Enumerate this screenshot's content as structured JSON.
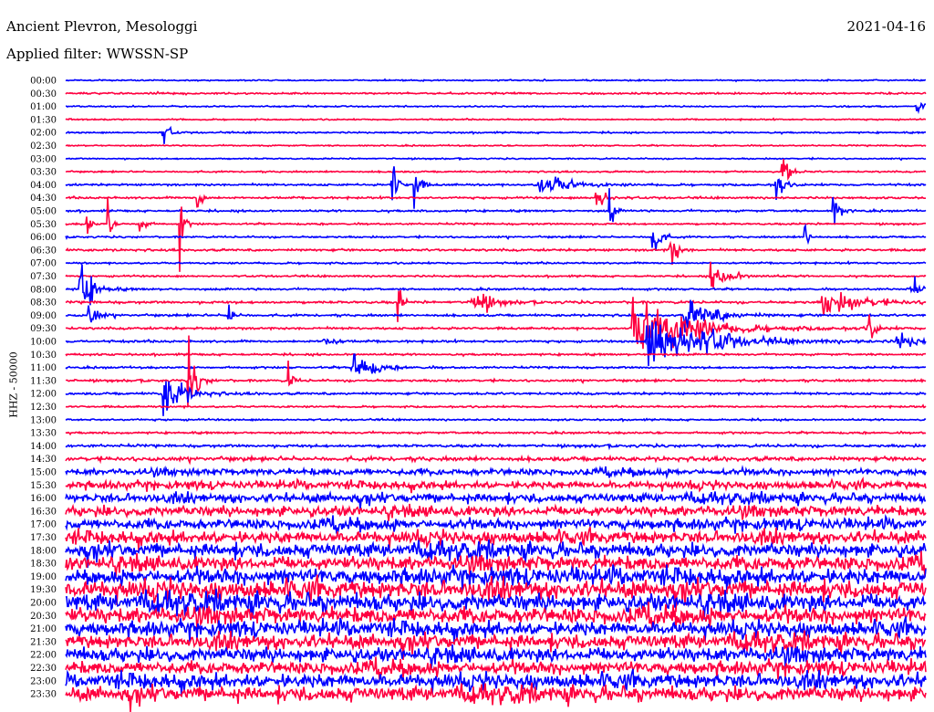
{
  "header": {
    "station": "Ancient Plevron, Mesologgi",
    "filter": "Applied filter: WWSSN-SP",
    "date": "2021-04-16"
  },
  "chart_data": {
    "type": "line",
    "title": "Ancient Plevron, Mesologgi",
    "subtitle": "Applied filter: WWSSN-SP",
    "ylabel": "HHZ - 50000",
    "xlabel": "",
    "minutes_per_row": 30,
    "colors": {
      "even": "#0000ff",
      "odd": "#ff0040"
    },
    "rows": [
      {
        "label": "00:00",
        "noise": 0.6
      },
      {
        "label": "00:30",
        "noise": 0.8
      },
      {
        "label": "01:00",
        "noise": 0.6
      },
      {
        "label": "01:30",
        "noise": 0.6
      },
      {
        "label": "02:00",
        "noise": 0.7
      },
      {
        "label": "02:30",
        "noise": 0.6
      },
      {
        "label": "03:00",
        "noise": 0.6
      },
      {
        "label": "03:30",
        "noise": 0.7
      },
      {
        "label": "04:00",
        "noise": 0.9
      },
      {
        "label": "04:30",
        "noise": 0.9
      },
      {
        "label": "05:00",
        "noise": 0.9
      },
      {
        "label": "05:30",
        "noise": 0.8
      },
      {
        "label": "06:00",
        "noise": 0.8
      },
      {
        "label": "06:30",
        "noise": 1.0
      },
      {
        "label": "07:00",
        "noise": 0.8
      },
      {
        "label": "07:30",
        "noise": 0.8
      },
      {
        "label": "08:00",
        "noise": 0.9
      },
      {
        "label": "08:30",
        "noise": 1.1
      },
      {
        "label": "09:00",
        "noise": 1.0
      },
      {
        "label": "09:30",
        "noise": 1.0
      },
      {
        "label": "10:00",
        "noise": 1.0
      },
      {
        "label": "10:30",
        "noise": 0.9
      },
      {
        "label": "11:00",
        "noise": 0.9
      },
      {
        "label": "11:30",
        "noise": 1.0
      },
      {
        "label": "12:00",
        "noise": 1.0
      },
      {
        "label": "12:30",
        "noise": 0.8
      },
      {
        "label": "13:00",
        "noise": 0.8
      },
      {
        "label": "13:30",
        "noise": 0.9
      },
      {
        "label": "14:00",
        "noise": 1.2
      },
      {
        "label": "14:30",
        "noise": 1.8
      },
      {
        "label": "15:00",
        "noise": 2.6
      },
      {
        "label": "15:30",
        "noise": 3.0
      },
      {
        "label": "16:00",
        "noise": 3.6
      },
      {
        "label": "16:30",
        "noise": 4.2
      },
      {
        "label": "17:00",
        "noise": 4.2
      },
      {
        "label": "17:30",
        "noise": 5.0
      },
      {
        "label": "18:00",
        "noise": 5.6
      },
      {
        "label": "18:30",
        "noise": 5.8
      },
      {
        "label": "19:00",
        "noise": 6.5
      },
      {
        "label": "19:30",
        "noise": 7.2
      },
      {
        "label": "20:00",
        "noise": 7.2
      },
      {
        "label": "20:30",
        "noise": 6.5
      },
      {
        "label": "21:00",
        "noise": 5.8
      },
      {
        "label": "21:30",
        "noise": 5.8
      },
      {
        "label": "22:00",
        "noise": 5.8
      },
      {
        "label": "22:30",
        "noise": 5.2
      },
      {
        "label": "23:00",
        "noise": 5.8
      },
      {
        "label": "23:30",
        "noise": 5.8
      }
    ],
    "events": [
      {
        "row": 2,
        "minute": 29.7,
        "amp": 0.5,
        "dur": 0.4
      },
      {
        "row": 4,
        "minute": 3.4,
        "amp": 0.8,
        "dur": 0.3
      },
      {
        "row": 7,
        "minute": 25.0,
        "amp": 1.4,
        "dur": 0.3
      },
      {
        "row": 8,
        "minute": 16.5,
        "amp": 0.8,
        "dur": 1.5
      },
      {
        "row": 8,
        "minute": 11.4,
        "amp": 2.5,
        "dur": 0.2
      },
      {
        "row": 8,
        "minute": 12.2,
        "amp": 2.5,
        "dur": 0.2
      },
      {
        "row": 8,
        "minute": 24.8,
        "amp": 1.2,
        "dur": 0.3
      },
      {
        "row": 9,
        "minute": 4.6,
        "amp": 1.5,
        "dur": 0.2
      },
      {
        "row": 9,
        "minute": 18.5,
        "amp": 1.0,
        "dur": 0.5
      },
      {
        "row": 10,
        "minute": 26.8,
        "amp": 1.2,
        "dur": 0.3
      },
      {
        "row": 10,
        "minute": 19.0,
        "amp": 1.3,
        "dur": 0.2
      },
      {
        "row": 11,
        "minute": 0.75,
        "amp": 1.5,
        "dur": 0.15
      },
      {
        "row": 11,
        "minute": 1.5,
        "amp": 1.2,
        "dur": 0.15
      },
      {
        "row": 11,
        "minute": 2.6,
        "amp": 1.5,
        "dur": 0.2
      },
      {
        "row": 11,
        "minute": 4.0,
        "amp": 2.0,
        "dur": 0.2
      },
      {
        "row": 12,
        "minute": 20.5,
        "amp": 2.0,
        "dur": 0.3
      },
      {
        "row": 12,
        "minute": 25.8,
        "amp": 1.0,
        "dur": 0.2
      },
      {
        "row": 13,
        "minute": 21.1,
        "amp": 1.5,
        "dur": 0.3
      },
      {
        "row": 15,
        "minute": 22.5,
        "amp": 0.8,
        "dur": 1.0
      },
      {
        "row": 16,
        "minute": 0.5,
        "amp": 2.0,
        "dur": 0.6
      },
      {
        "row": 16,
        "minute": 29.5,
        "amp": 1.0,
        "dur": 0.3
      },
      {
        "row": 17,
        "minute": 14.2,
        "amp": 1.0,
        "dur": 0.8
      },
      {
        "row": 17,
        "minute": 26.4,
        "amp": 0.8,
        "dur": 2.0
      },
      {
        "row": 17,
        "minute": 11.6,
        "amp": 1.2,
        "dur": 0.2
      },
      {
        "row": 18,
        "minute": 0.8,
        "amp": 1.0,
        "dur": 0.4
      },
      {
        "row": 18,
        "minute": 21.6,
        "amp": 1.0,
        "dur": 1.5
      },
      {
        "row": 18,
        "minute": 5.7,
        "amp": 1.2,
        "dur": 0.2
      },
      {
        "row": 19,
        "minute": 19.8,
        "amp": 2.0,
        "dur": 3.0
      },
      {
        "row": 19,
        "minute": 28.0,
        "amp": 1.0,
        "dur": 0.3
      },
      {
        "row": 20,
        "minute": 20.3,
        "amp": 2.0,
        "dur": 3.0
      },
      {
        "row": 20,
        "minute": 29.0,
        "amp": 0.5,
        "dur": 1.0
      },
      {
        "row": 20,
        "minute": 9.0,
        "amp": 0.4,
        "dur": 0.5
      },
      {
        "row": 22,
        "minute": 10.0,
        "amp": 1.0,
        "dur": 1.0
      },
      {
        "row": 23,
        "minute": 4.3,
        "amp": 2.0,
        "dur": 0.4
      },
      {
        "row": 23,
        "minute": 7.8,
        "amp": 0.8,
        "dur": 0.2
      },
      {
        "row": 24,
        "minute": 3.4,
        "amp": 1.5,
        "dur": 1.0
      }
    ]
  }
}
